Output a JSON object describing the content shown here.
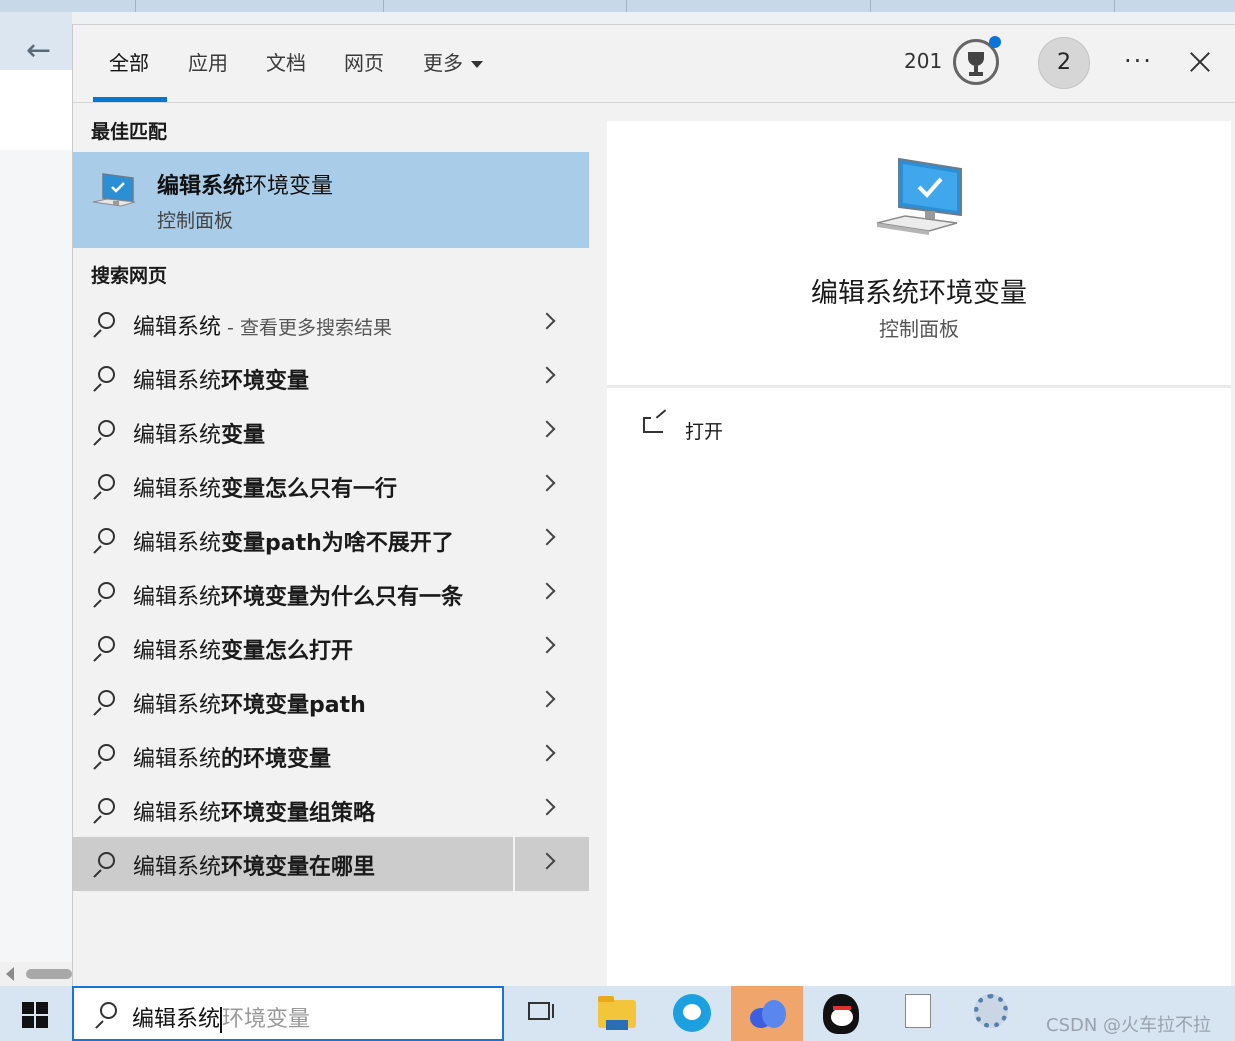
{
  "tabs": [
    {
      "label": "全部",
      "active": true
    },
    {
      "label": "应用"
    },
    {
      "label": "文档"
    },
    {
      "label": "网页"
    },
    {
      "label": "更多"
    }
  ],
  "header": {
    "points": "201",
    "avatar_initial": "2",
    "more_label": "···"
  },
  "best_match": {
    "section_label": "最佳匹配",
    "title_bold": "编辑系统",
    "title_rest": "环境变量",
    "subtitle": "控制面板",
    "icon": "computer-icon"
  },
  "web_section_label": "搜索网页",
  "web_results": [
    {
      "prefix": "编辑系统",
      "bold": "",
      "hint": " - 查看更多搜索结果"
    },
    {
      "prefix": "编辑系统",
      "bold": "环境变量",
      "hint": ""
    },
    {
      "prefix": "编辑系统",
      "bold": "变量",
      "hint": ""
    },
    {
      "prefix": "编辑系统",
      "bold": "变量怎么只有一行",
      "hint": ""
    },
    {
      "prefix": "编辑系统",
      "bold": "变量path为啥不展开了",
      "hint": ""
    },
    {
      "prefix": "编辑系统",
      "bold": "环境变量为什么只有一条",
      "hint": ""
    },
    {
      "prefix": "编辑系统",
      "bold": "变量怎么打开",
      "hint": ""
    },
    {
      "prefix": "编辑系统",
      "bold": "环境变量path",
      "hint": ""
    },
    {
      "prefix": "编辑系统",
      "bold": "的环境变量",
      "hint": ""
    },
    {
      "prefix": "编辑系统",
      "bold": "环境变量组策略",
      "hint": ""
    },
    {
      "prefix": "编辑系统",
      "bold": "环境变量在哪里",
      "hint": "",
      "selected": true
    }
  ],
  "preview": {
    "title": "编辑系统环境变量",
    "subtitle": "控制面板",
    "action_label": "打开"
  },
  "search_box": {
    "typed": "编辑系统",
    "suggestion": "环境变量"
  },
  "taskbar": {
    "watermark": "CSDN @火车拉不拉"
  },
  "colors": {
    "accent": "#0078d4",
    "best_match_bg": "#a9cce8",
    "selected_row_bg": "#cccccc",
    "highlight_app_bg": "#f0a56c"
  }
}
